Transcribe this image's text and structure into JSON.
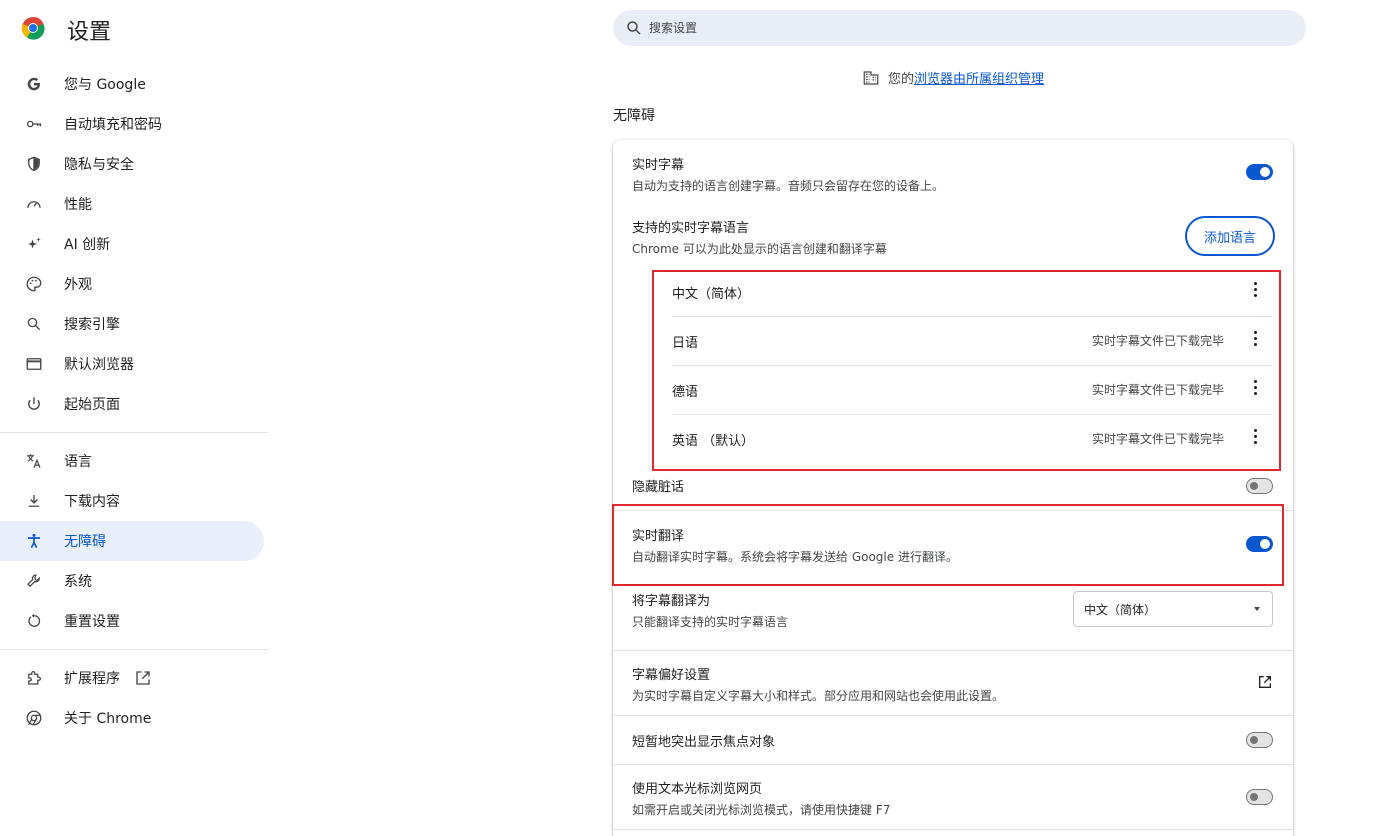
{
  "app": {
    "title": "设置"
  },
  "search": {
    "placeholder": "搜索设置"
  },
  "sidebar": {
    "items": [
      {
        "label": "您与 Google",
        "icon": "google-g-icon"
      },
      {
        "label": "自动填充和密码",
        "icon": "key-icon"
      },
      {
        "label": "隐私与安全",
        "icon": "shield-icon"
      },
      {
        "label": "性能",
        "icon": "speedometer-icon"
      },
      {
        "label": "AI 创新",
        "icon": "sparkle-icon"
      },
      {
        "label": "外观",
        "icon": "palette-icon"
      },
      {
        "label": "搜索引擎",
        "icon": "search-icon"
      },
      {
        "label": "默认浏览器",
        "icon": "browser-window-icon"
      },
      {
        "label": "起始页面",
        "icon": "power-icon"
      },
      {
        "label": "语言",
        "icon": "translate-icon"
      },
      {
        "label": "下载内容",
        "icon": "download-icon"
      },
      {
        "label": "无障碍",
        "icon": "accessibility-icon",
        "active": true
      },
      {
        "label": "系统",
        "icon": "wrench-icon"
      },
      {
        "label": "重置设置",
        "icon": "reset-icon"
      },
      {
        "label": "扩展程序",
        "icon": "puzzle-icon"
      },
      {
        "label": "关于 Chrome",
        "icon": "chrome-icon"
      }
    ]
  },
  "managed": {
    "prefix": "您的",
    "link": "浏览器由所属组织管理"
  },
  "section": {
    "title": "无障碍"
  },
  "live_caption": {
    "title": "实时字幕",
    "desc": "自动为支持的语言创建字幕。音频只会留存在您的设备上。",
    "enabled": true
  },
  "caption_languages": {
    "title": "支持的实时字幕语言",
    "desc": "Chrome 可以为此处显示的语言创建和翻译字幕",
    "add_button": "添加语言",
    "items": [
      {
        "name": "中文（简体）",
        "status": ""
      },
      {
        "name": "日语",
        "status": "实时字幕文件已下载完毕"
      },
      {
        "name": "德语",
        "status": "实时字幕文件已下载完毕"
      },
      {
        "name": "英语 （默认）",
        "status": "实时字幕文件已下载完毕"
      }
    ]
  },
  "hide_profanity": {
    "title": "隐藏脏话",
    "enabled": false
  },
  "live_translate": {
    "title": "实时翻译",
    "desc": "自动翻译实时字幕。系统会将字幕发送给 Google 进行翻译。",
    "enabled": true
  },
  "translate_to": {
    "title": "将字幕翻译为",
    "desc": "只能翻译支持的实时字幕语言",
    "selected": "中文（简体）"
  },
  "caption_prefs": {
    "title": "字幕偏好设置",
    "desc": "为实时字幕自定义字幕大小和样式。部分应用和网站也会使用此设置。"
  },
  "focus_highlight": {
    "title": "短暂地突出显示焦点对象",
    "enabled": false
  },
  "caret_browsing": {
    "title": "使用文本光标浏览网页",
    "desc": "如需开启或关闭光标浏览模式，请使用快捷键 F7",
    "enabled": false
  },
  "colors": {
    "accent": "#0b57d0",
    "highlight": "#e3262b",
    "active_bg": "#e8effb"
  }
}
